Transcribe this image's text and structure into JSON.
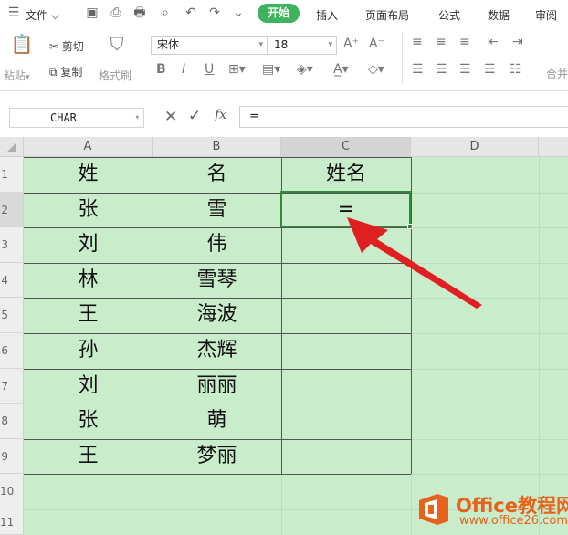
{
  "menubar": {
    "menu_label": "文件",
    "tabs": [
      "开始",
      "插入",
      "页面布局",
      "公式",
      "数据",
      "审阅"
    ]
  },
  "ribbon": {
    "paste_label": "粘贴",
    "cut_label": "剪切",
    "copy_label": "复制",
    "format_painter_label": "格式刷",
    "font_name": "宋体",
    "font_size": "18",
    "merge_label": "合并"
  },
  "formula_bar": {
    "name_box": "CHAR",
    "fx_label": "fx",
    "formula": "="
  },
  "columns": [
    "A",
    "B",
    "C",
    "D"
  ],
  "rows": [
    "1",
    "2",
    "3",
    "4",
    "5",
    "6",
    "7",
    "8",
    "9",
    "10",
    "11"
  ],
  "table": [
    [
      "姓",
      "名",
      "姓名"
    ],
    [
      "张",
      "雪",
      "="
    ],
    [
      "刘",
      "伟",
      ""
    ],
    [
      "林",
      "雪琴",
      ""
    ],
    [
      "王",
      "海波",
      ""
    ],
    [
      "孙",
      "杰辉",
      ""
    ],
    [
      "刘",
      "丽丽",
      ""
    ],
    [
      "张",
      "萌",
      ""
    ],
    [
      "王",
      "梦丽",
      ""
    ]
  ],
  "watermark": {
    "brand": "Office教程网",
    "url": "www.office26.com"
  },
  "colors": {
    "sheet_fill": "#c9ecca",
    "accent_green": "#3db35e",
    "arrow_red": "#e02020",
    "watermark_orange": "#e8621c"
  }
}
